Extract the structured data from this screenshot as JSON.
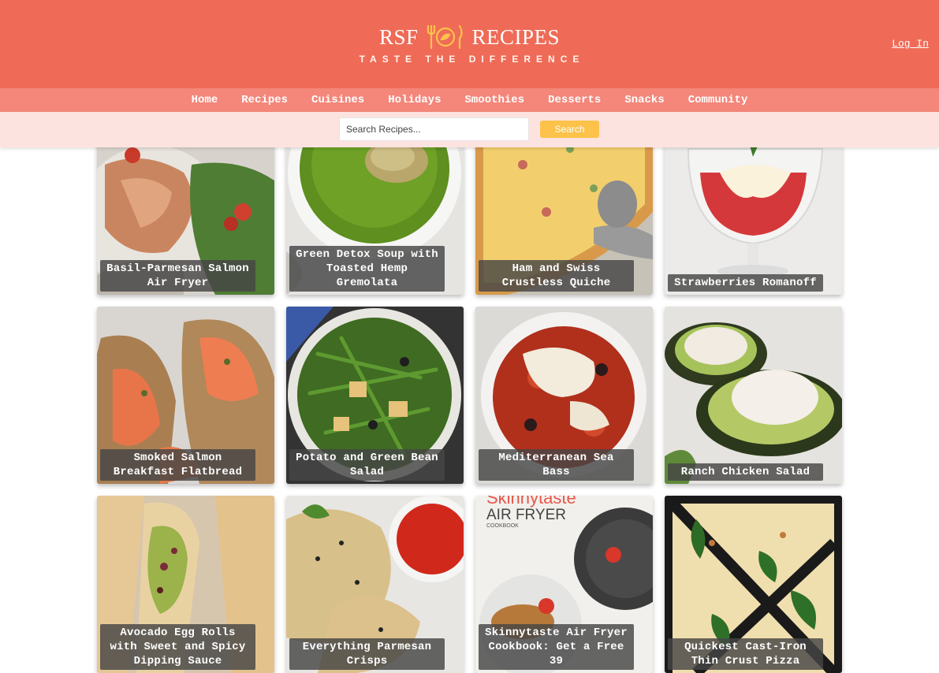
{
  "header": {
    "logo_left": "RSF",
    "logo_right": "RECIPES",
    "tagline": "TASTE THE DIFFERENCE",
    "login_label": "Log In",
    "icon": "fork-plate-knife-icon"
  },
  "nav": {
    "items": [
      "Home",
      "Recipes",
      "Cuisines",
      "Holidays",
      "Smoothies",
      "Desserts",
      "Snacks",
      "Community"
    ]
  },
  "search": {
    "placeholder": "Search Recipes...",
    "button_label": "Search"
  },
  "recipes": [
    {
      "title": "Basil-Parmesan Salmon Air Fryer"
    },
    {
      "title": "Green Detox Soup with Toasted Hemp Gremolata"
    },
    {
      "title": "Ham and Swiss Crustless Quiche"
    },
    {
      "title": "Strawberries Romanoff"
    },
    {
      "title": "Smoked Salmon Breakfast Flatbread"
    },
    {
      "title": "Potato and Green Bean Salad"
    },
    {
      "title": "Mediterranean Sea Bass"
    },
    {
      "title": "Ranch Chicken Salad"
    },
    {
      "title": "Avocado Egg Rolls with Sweet and Spicy Dipping Sauce"
    },
    {
      "title": "Everything Parmesan Crisps"
    },
    {
      "title": "Skinnytaste Air Fryer Cookbook: Get a Free 39"
    },
    {
      "title": "Quickest Cast-Iron Thin Crust Pizza"
    }
  ],
  "colors": {
    "header": "#ef6b57",
    "nav": "#f4867a",
    "search_strip": "#fde3df",
    "search_button": "#fcc24a",
    "logo_icon": "#fcc24a"
  }
}
